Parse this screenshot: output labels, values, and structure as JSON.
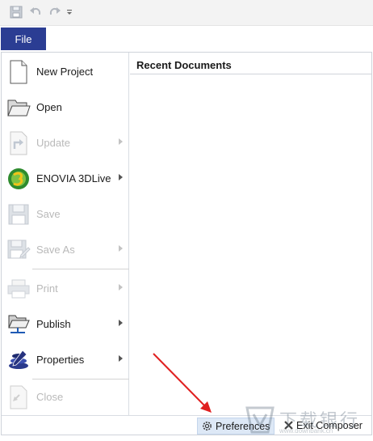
{
  "quick_access": {
    "icons": [
      "save-icon",
      "undo-icon",
      "redo-icon",
      "customize-dropdown-icon"
    ]
  },
  "file_tab": {
    "label": "File"
  },
  "menu": {
    "items": [
      {
        "label": "New Project",
        "icon": "new-document-icon",
        "enabled": true,
        "submenu": false
      },
      {
        "label": "Open",
        "icon": "folder-open-icon",
        "enabled": true,
        "submenu": false
      },
      {
        "label": "Update",
        "icon": "update-icon",
        "enabled": false,
        "submenu": true
      },
      {
        "label": "ENOVIA 3DLive",
        "icon": "enovia-3dlive-icon",
        "enabled": true,
        "submenu": true
      },
      {
        "label": "Save",
        "icon": "save-icon",
        "enabled": false,
        "submenu": false
      },
      {
        "label": "Save As",
        "icon": "save-as-icon",
        "enabled": false,
        "submenu": true
      },
      {
        "label": "Print",
        "icon": "print-icon",
        "enabled": false,
        "submenu": true
      },
      {
        "label": "Publish",
        "icon": "publish-icon",
        "enabled": true,
        "submenu": true
      },
      {
        "label": "Properties",
        "icon": "properties-icon",
        "enabled": true,
        "submenu": true
      },
      {
        "label": "Close",
        "icon": "close-document-icon",
        "enabled": false,
        "submenu": false
      }
    ]
  },
  "recent": {
    "title": "Recent Documents"
  },
  "footer": {
    "preferences_label": "Preferences",
    "exit_label": "Exit Composer"
  },
  "watermark": {
    "text": "下载银行",
    "sub": "www.downbank.cn"
  },
  "colors": {
    "file_tab": "#2b3d93",
    "annotation_arrow": "#e02020",
    "preferences_highlight": "#dde8f6"
  }
}
